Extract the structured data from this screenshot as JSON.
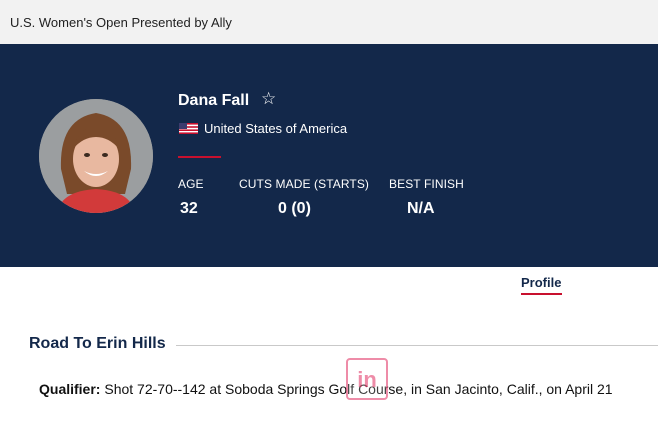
{
  "header": {
    "title": "U.S. Women's Open Presented by Ally"
  },
  "player": {
    "name": "Dana Fall",
    "favorite_icon": "star-outline-icon",
    "country": "United States of America",
    "flag_icon": "us-flag-icon"
  },
  "stats": [
    {
      "label": "AGE",
      "value": "32"
    },
    {
      "label": "CUTS MADE (STARTS)",
      "value": "0 (0)"
    },
    {
      "label": "BEST FINISH",
      "value": "N/A"
    }
  ],
  "tabs": [
    {
      "label": "Profile",
      "active": true
    }
  ],
  "section": {
    "title": "Road To Erin Hills"
  },
  "qualifier": {
    "label": "Qualifier:",
    "text": " Shot 72-70--142 at Soboda Springs Golf Course, in San Jacinto, Calif., on April 21"
  },
  "watermark": {
    "text": "in"
  },
  "colors": {
    "navy": "#13284a",
    "accent_red": "#c8102e",
    "topbar_bg": "#f2f2f2"
  }
}
